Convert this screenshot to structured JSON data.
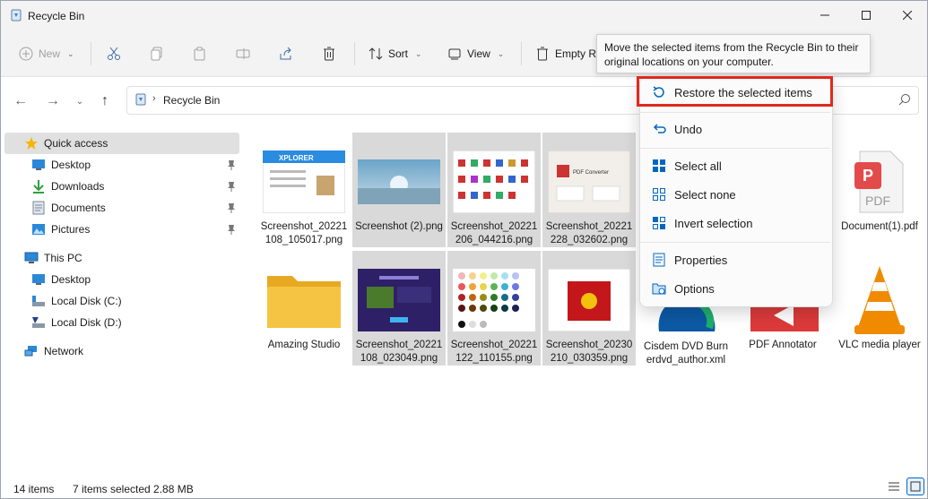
{
  "window": {
    "title": "Recycle Bin"
  },
  "toolbar": {
    "new_label": "New",
    "sort_label": "Sort",
    "view_label": "View",
    "empty_label": "Empty R"
  },
  "address": {
    "location": "Recycle Bin"
  },
  "sidebar": {
    "quick_access": "Quick access",
    "items": [
      {
        "label": "Desktop"
      },
      {
        "label": "Downloads"
      },
      {
        "label": "Documents"
      },
      {
        "label": "Pictures"
      }
    ],
    "this_pc": "This PC",
    "pc_items": [
      {
        "label": "Desktop"
      },
      {
        "label": "Local Disk (C:)"
      },
      {
        "label": "Local Disk (D:)"
      }
    ],
    "network": "Network"
  },
  "files": [
    {
      "name": "Screenshot_20221108_105017.png",
      "thumb_text": "XPLORER"
    },
    {
      "name": "Screenshot (2).png"
    },
    {
      "name": "Screenshot_20221206_044216.png"
    },
    {
      "name": "Screenshot_20221228_032602.png",
      "thumb_text": "PDF Converter"
    },
    {
      "name": "Document(1).pdf",
      "thumb_text": "PDF"
    },
    {
      "name": "Amazing Studio"
    },
    {
      "name": "Screenshot_20221108_023049.png"
    },
    {
      "name": "Screenshot_20221122_110155.png"
    },
    {
      "name": "Screenshot_20230210_030359.png"
    },
    {
      "name": "Cisdem DVD Burnerdvd_author.xml"
    },
    {
      "name": "PDF Annotator"
    },
    {
      "name": "VLC media player"
    }
  ],
  "tooltip": {
    "text": "Move the selected items from the Recycle Bin to their original locations on your computer."
  },
  "menu": {
    "restore": "Restore the selected items",
    "undo": "Undo",
    "select_all": "Select all",
    "select_none": "Select none",
    "invert": "Invert selection",
    "properties": "Properties",
    "options": "Options"
  },
  "status": {
    "items": "14 items",
    "selected": "7 items selected  2.88 MB"
  },
  "colors": {
    "accent": "#0067c0",
    "highlight": "#e0291e",
    "selection": "#d9d9d9"
  }
}
